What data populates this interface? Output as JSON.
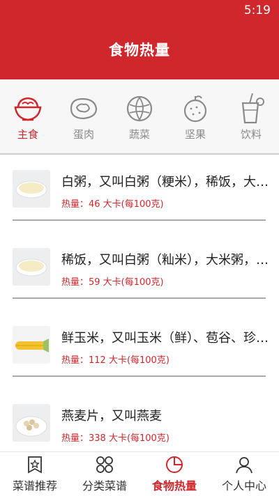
{
  "status_bar": {
    "time": "5:19"
  },
  "header": {
    "title": "食物热量"
  },
  "categories": [
    {
      "label": "主食",
      "icon": "bowl-icon",
      "active": true
    },
    {
      "label": "蛋肉",
      "icon": "meat-icon",
      "active": false
    },
    {
      "label": "蔬菜",
      "icon": "cabbage-icon",
      "active": false
    },
    {
      "label": "坚果",
      "icon": "nut-icon",
      "active": false
    },
    {
      "label": "饮料",
      "icon": "drink-icon",
      "active": false
    }
  ],
  "foods": [
    {
      "name": "白粥，又叫白粥（粳米），稀饭，大米粥",
      "calories": "热量：46 大卡(每100克)",
      "thumb": "rice-porridge-image"
    },
    {
      "name": "稀饭，又叫白粥（籼米），大米粥，白粥",
      "calories": "热量：59 大卡(每100克)",
      "thumb": "rice-porridge-image"
    },
    {
      "name": "鲜玉米，又叫玉米（鲜）、苞谷、珍珠米",
      "calories": "热量：112 大卡(每100克)",
      "thumb": "corn-image"
    },
    {
      "name": "燕麦片，又叫燕麦",
      "calories": "热量：338 大卡(每100克)",
      "thumb": "oats-image"
    }
  ],
  "tabs": [
    {
      "label": "菜谱推荐",
      "icon": "star-book-icon",
      "active": false
    },
    {
      "label": "分类菜谱",
      "icon": "grid-icon",
      "active": false
    },
    {
      "label": "食物热量",
      "icon": "chart-icon",
      "active": true
    },
    {
      "label": "个人中心",
      "icon": "user-icon",
      "active": false
    }
  ],
  "colors": {
    "primary": "#d0272c",
    "inactive": "#8a8a8a"
  }
}
